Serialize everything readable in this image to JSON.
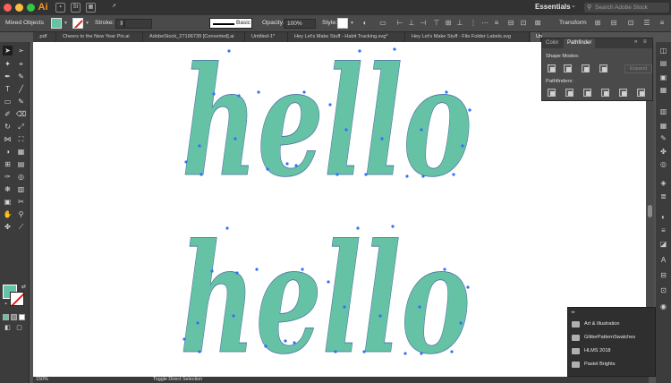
{
  "app": {
    "logo_text": "Ai",
    "workspace": "Essentials",
    "search_placeholder": "Search Adobe Stock"
  },
  "control_bar": {
    "selection_label": "Mixed Objects",
    "stroke_label": "Stroke:",
    "brush_name": "Basic",
    "opacity_label": "Opacity:",
    "opacity_value": "100%",
    "style_label": "Style:",
    "transform_label": "Transform",
    "fill_color": "#66c2a5"
  },
  "tabs": [
    ".pdf",
    "Cheers to the New Year Pin.ai",
    "AdobeStock_27196739 [Converted].ai",
    "Untitled-1*",
    "Hey Let's Make Stuff - Habit Tracking.svg*",
    "Hey Let's Make Stuff - File Folder Labels.svg",
    "Un"
  ],
  "canvas": {
    "word_top": "hello",
    "word_bottom": "hello",
    "letter_color": "#66c2a5",
    "anchor_color": "#2f6fff"
  },
  "pathfinder": {
    "tab_color": "Color",
    "tab_pathfinder": "Pathfinder",
    "shape_modes_label": "Shape Modes:",
    "expand_label": "Expand",
    "pathfinders_label": "Pathfinders:"
  },
  "libraries": [
    "Art & Illustration",
    "GlitterPatternSwatches",
    "HLMS 2018",
    "Pastel Brights"
  ],
  "status": {
    "zoom": "150%",
    "tool_hint": "Toggle Direct Selection"
  }
}
